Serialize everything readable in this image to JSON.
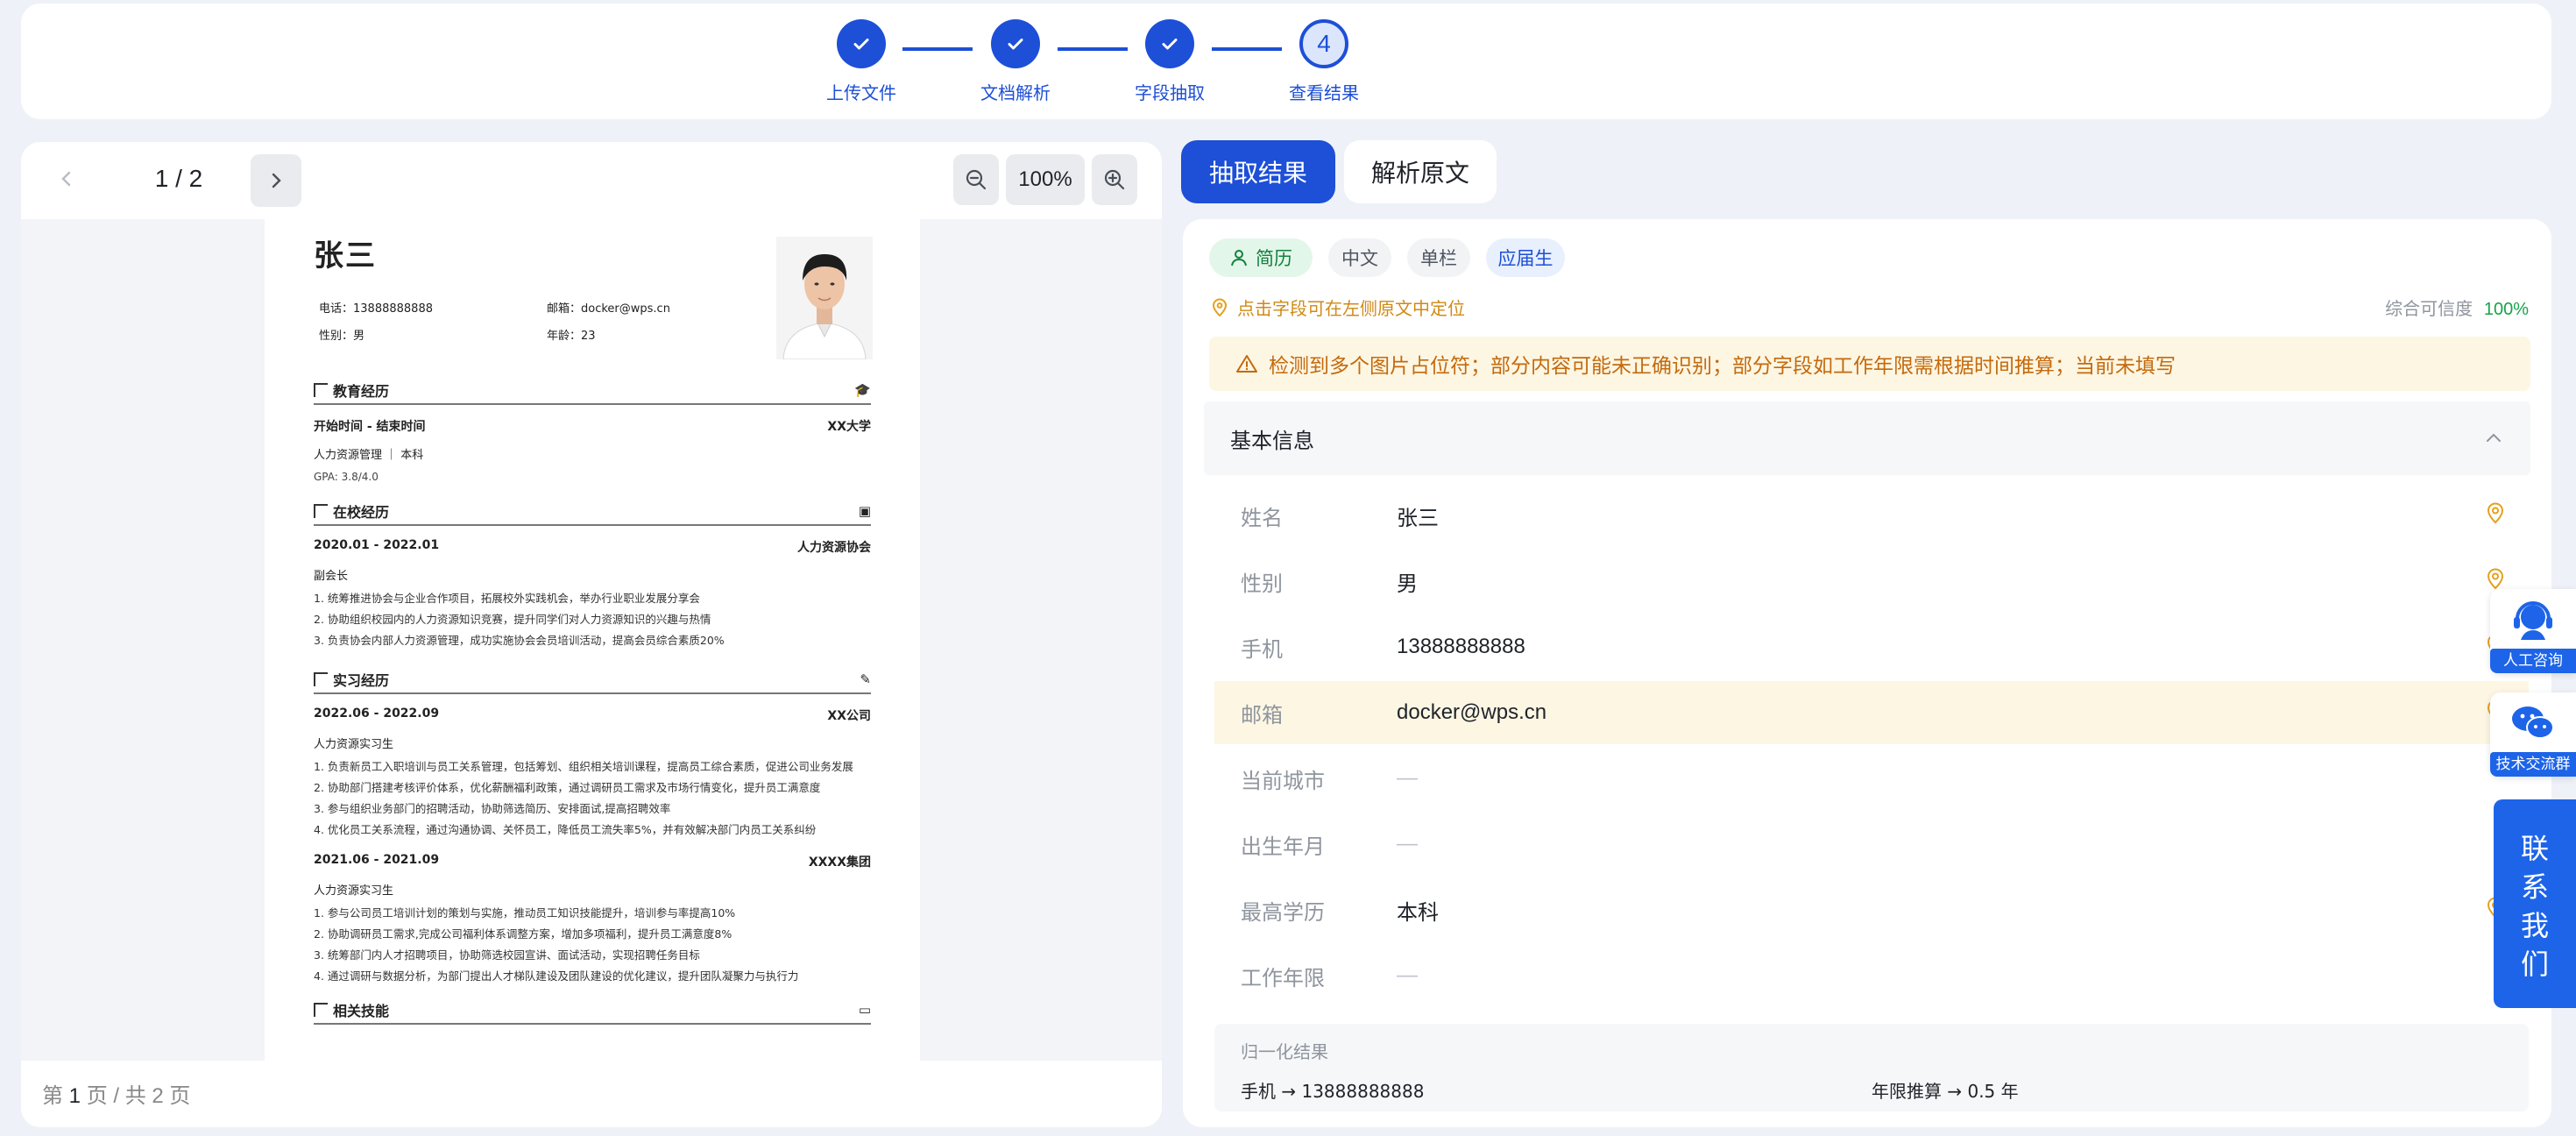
{
  "stepper": {
    "steps": [
      {
        "label": "上传文件",
        "state": "done"
      },
      {
        "label": "文档解析",
        "state": "done"
      },
      {
        "label": "字段抽取",
        "state": "done"
      },
      {
        "label": "查看结果",
        "state": "current",
        "number": "4"
      }
    ],
    "accent": "#1d4fd7"
  },
  "viewer": {
    "page_indicator": "1 / 2",
    "zoom": "100%",
    "footer": {
      "prefix": "第",
      "current": "1",
      "middle": "页 / 共",
      "total": "2",
      "suffix": "页"
    }
  },
  "resume": {
    "name": "张三",
    "phone": "电话：13888888888",
    "email": "邮箱：docker@wps.cn",
    "gender": "性别：男",
    "age": "年龄：23",
    "sections": {
      "education": {
        "title": "教育经历",
        "period": "开始时间 - 结束时间",
        "school": "XX大学",
        "major": "人力资源管理 ｜ 本科",
        "gpa": "GPA: 3.8/4.0"
      },
      "campus": {
        "title": "在校经历",
        "period": "2020.01 - 2022.01",
        "org": "人力资源协会",
        "role": "副会长",
        "items": [
          "1. 统筹推进协会与企业合作项目，拓展校外实践机会，举办行业职业发展分享会",
          "2. 协助组织校园内的人力资源知识竞赛，提升同学们对人力资源知识的兴趣与热情",
          "3. 负责协会内部人力资源管理，成功实施协会会员培训活动，提高会员综合素质20%"
        ]
      },
      "internship": {
        "title": "实习经历",
        "jobs": [
          {
            "period": "2022.06 - 2022.09",
            "company": "XX公司",
            "role": "人力资源实习生",
            "items": [
              "1. 负责新员工入职培训与员工关系管理，包括筹划、组织相关培训课程，提高员工综合素质，促进公司业务发展",
              "2. 协助部门搭建考核评价体系，优化薪酬福利政策，通过调研员工需求及市场行情变化，提升员工满意度",
              "3. 参与组织业务部门的招聘活动，协助筛选简历、安排面试,提高招聘效率",
              "4. 优化员工关系流程，通过沟通协调、关怀员工，降低员工流失率5%，并有效解决部门内员工关系纠纷"
            ]
          },
          {
            "period": "2021.06 - 2021.09",
            "company": "XXXX集团",
            "role": "人力资源实习生",
            "items": [
              "1. 参与公司员工培训计划的策划与实施，推动员工知识技能提升，培训参与率提高10%",
              "2. 协助调研员工需求,完成公司福利体系调整方案，增加多项福利，提升员工满意度8%",
              "3. 统筹部门内人才招聘项目，协助筛选校园宣讲、面试活动，实现招聘任务目标",
              "4. 通过调研与数据分析，为部门提出人才梯队建设及团队建设的优化建议，提升团队凝聚力与执行力"
            ]
          }
        ]
      },
      "skills": {
        "title": "相关技能"
      }
    }
  },
  "tabs": {
    "extract": "抽取结果",
    "raw": "解析原文"
  },
  "result": {
    "tags": [
      "简历",
      "中文",
      "单栏",
      "应届生"
    ],
    "hint": "点击字段可在左侧原文中定位",
    "confidence_label": "综合可信度",
    "confidence_value": "100%",
    "warning": "检测到多个图片占位符；部分内容可能未正确识别；部分字段如工作年限需根据时间推算；当前未填写",
    "section_title": "基本信息",
    "fields": [
      {
        "key": "姓名",
        "value": "张三"
      },
      {
        "key": "性别",
        "value": "男"
      },
      {
        "key": "手机",
        "value": "13888888888"
      },
      {
        "key": "邮箱",
        "value": "docker@wps.cn"
      },
      {
        "key": "当前城市",
        "value": "—"
      },
      {
        "key": "出生年月",
        "value": "—"
      },
      {
        "key": "最高学历",
        "value": "本科"
      },
      {
        "key": "工作年限",
        "value": "—"
      }
    ],
    "normalized": {
      "title": "归一化结果",
      "items": [
        "手机 → 13888888888",
        "年限推算 → 0.5 年"
      ]
    }
  },
  "floating": {
    "service": "人工咨询",
    "group": "技术交流群",
    "contact": [
      "联",
      "系",
      "我",
      "们"
    ]
  }
}
